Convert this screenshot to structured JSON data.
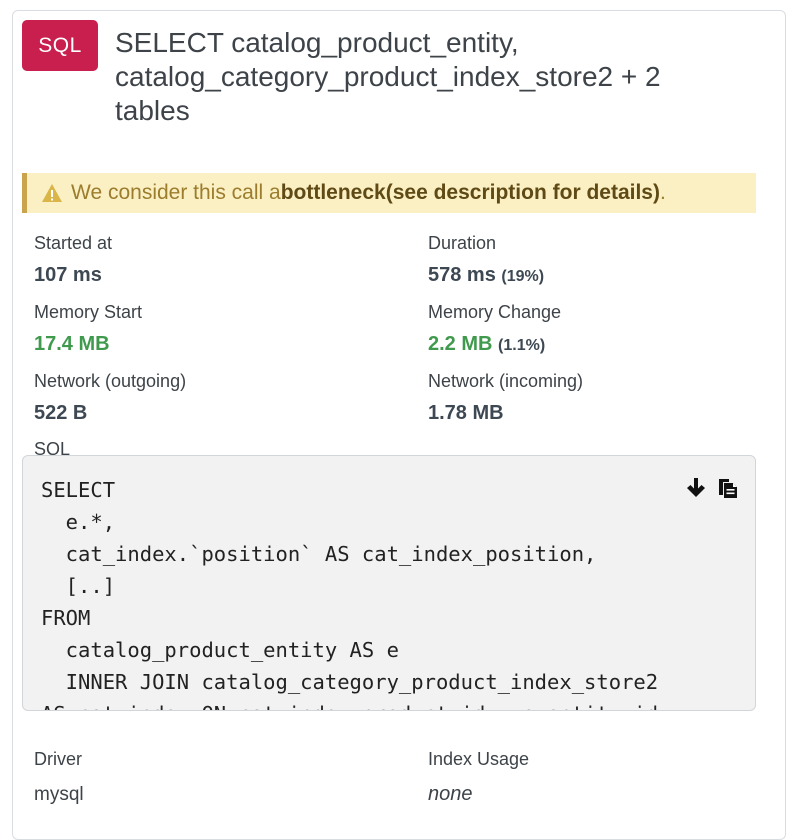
{
  "header": {
    "badge": "SQL",
    "title": "SELECT catalog_product_entity, catalog_category_product_index_store2 + 2 tables"
  },
  "alert": {
    "prefix": "We consider this call a ",
    "strong1": "bottleneck",
    "strong2": " (see description for details)",
    "suffix": "."
  },
  "stats": {
    "started_at": {
      "label": "Started at",
      "value": "107 ms"
    },
    "duration": {
      "label": "Duration",
      "value": "578 ms",
      "pct": "(19%)"
    },
    "memory_start": {
      "label": "Memory Start",
      "value": "17.4 MB"
    },
    "memory_change": {
      "label": "Memory Change",
      "value": "2.2 MB",
      "pct": "(1.1%)"
    },
    "network_out": {
      "label": "Network (outgoing)",
      "value": "522 B"
    },
    "network_in": {
      "label": "Network (incoming)",
      "value": "1.78 MB"
    }
  },
  "sql": {
    "label": "SQL",
    "code": "SELECT\n  e.*,\n  cat_index.`position` AS cat_index_position,\n  [..]\nFROM\n  catalog_product_entity AS e\n  INNER JOIN catalog_category_product_index_store2\nAS cat_index ON cat_index.product_id = e.entity_id",
    "actions": {
      "download_icon": "arrow-down-icon",
      "copy_icon": "copy-icon"
    }
  },
  "details": {
    "driver": {
      "label": "Driver",
      "value": "mysql"
    },
    "index_usage": {
      "label": "Index Usage",
      "value": "none"
    }
  },
  "colors": {
    "badge": "#c81f4f",
    "alert_bg": "#faf0c3",
    "alert_border": "#c9a44c",
    "green": "#3f9a4d"
  }
}
